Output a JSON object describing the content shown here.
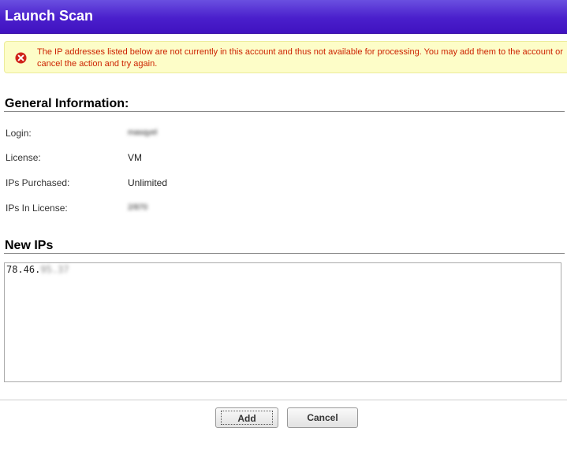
{
  "window": {
    "title": "Launch Scan"
  },
  "alert": {
    "icon": "error-icon",
    "message": "The IP addresses listed below are not currently in this account and thus not available for processing. You may add them to the account or cancel the action and try again.",
    "color": "#cc2200"
  },
  "general": {
    "title": "General Information:",
    "rows": [
      {
        "label": "Login:",
        "value": "masqyel"
      },
      {
        "label": "License:",
        "value": "VM"
      },
      {
        "label": "IPs Purchased:",
        "value": "Unlimited"
      },
      {
        "label": "IPs In License:",
        "value": "2/870"
      }
    ]
  },
  "new_ips": {
    "title": "New IPs",
    "visible_prefix": "78.46.",
    "masked_suffix": "95.37"
  },
  "buttons": {
    "add": "Add",
    "cancel": "Cancel"
  },
  "colors": {
    "titlebar": "#4a1fcc",
    "alert_bg": "#fdfdc8"
  }
}
